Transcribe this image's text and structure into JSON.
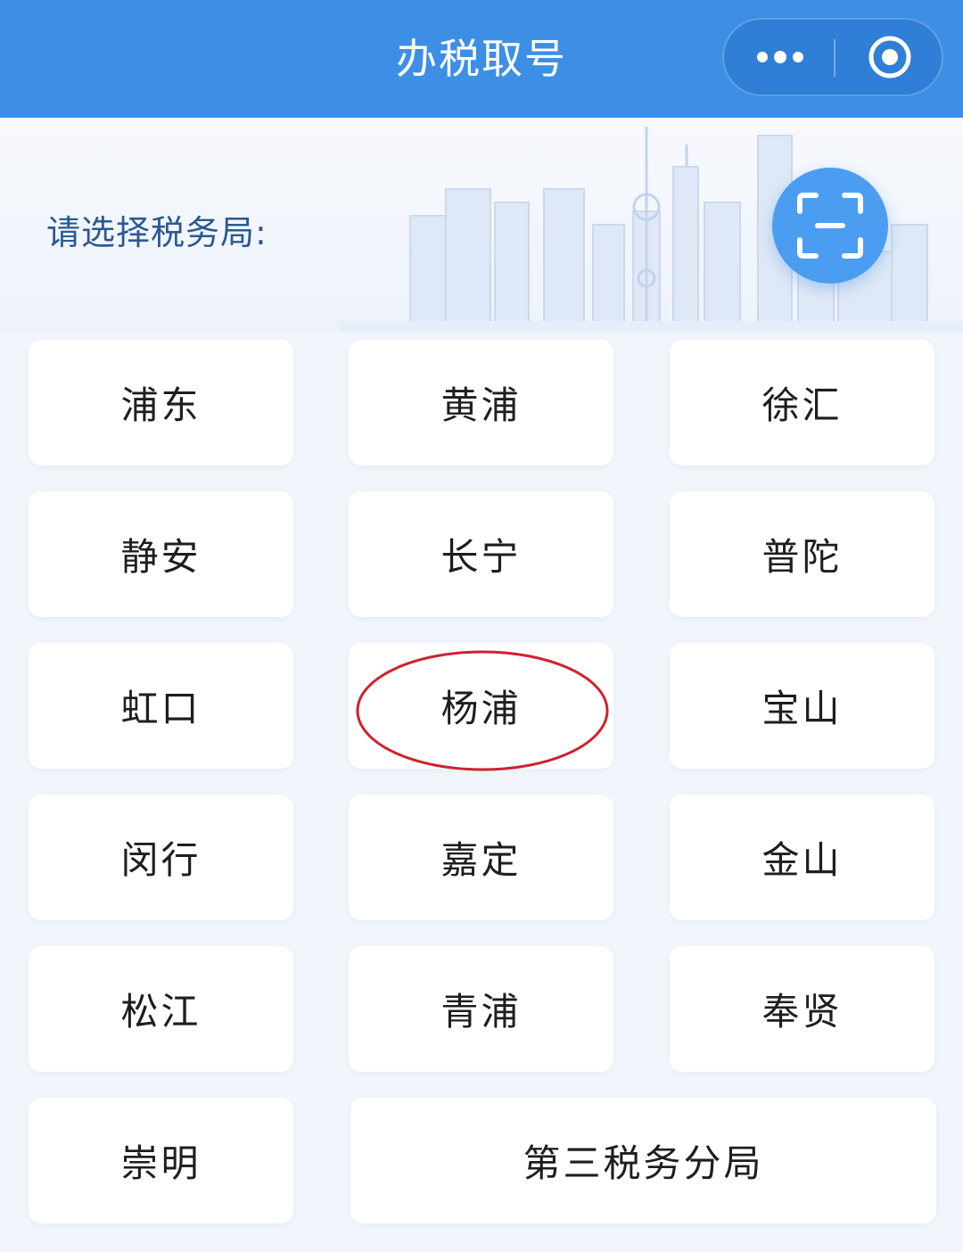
{
  "header": {
    "title": "办税取号",
    "bg_color": "#3c8fe4"
  },
  "capsule": {
    "more_icon": "more-dots-icon",
    "close_icon": "target-circle-icon"
  },
  "banner": {
    "prompt": "请选择税务局:",
    "scan_icon": "scan-icon"
  },
  "offices": [
    {
      "label": "浦东"
    },
    {
      "label": "黄浦"
    },
    {
      "label": "徐汇"
    },
    {
      "label": "静安"
    },
    {
      "label": "长宁"
    },
    {
      "label": "普陀"
    },
    {
      "label": "虹口"
    },
    {
      "label": "杨浦",
      "circled": true
    },
    {
      "label": "宝山"
    },
    {
      "label": "闵行"
    },
    {
      "label": "嘉定"
    },
    {
      "label": "金山"
    },
    {
      "label": "松江"
    },
    {
      "label": "青浦"
    },
    {
      "label": "奉贤"
    },
    {
      "label": "崇明"
    },
    {
      "label": "第三税务分局"
    }
  ],
  "annotation_color": "#d0212f"
}
